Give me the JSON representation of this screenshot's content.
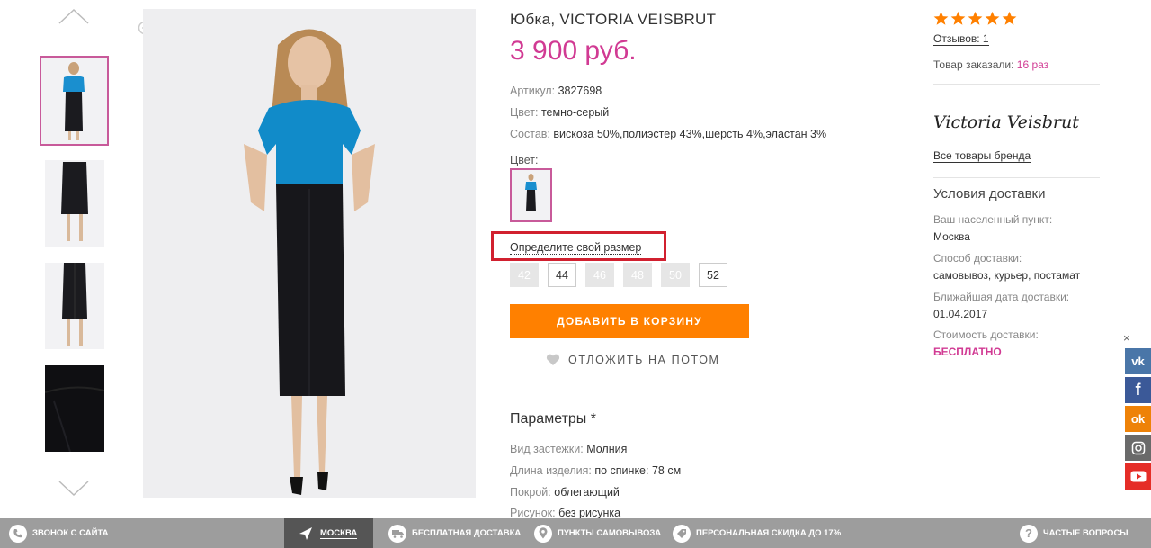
{
  "product": {
    "title": "Юбка, VICTORIA VEISBRUT",
    "price": "3 900 руб.",
    "attributes": [
      {
        "label": "Артикул:",
        "value": "3827698"
      },
      {
        "label": "Цвет:",
        "value": "темно-серый"
      },
      {
        "label": "Состав:",
        "value": "вискоза 50%,полиэстер 43%,шерсть 4%,эластан 3%"
      }
    ],
    "color_label": "Цвет:",
    "size_link": "Определите свой размер",
    "sizes": [
      {
        "label": "42",
        "available": false
      },
      {
        "label": "44",
        "available": true
      },
      {
        "label": "46",
        "available": false
      },
      {
        "label": "48",
        "available": false
      },
      {
        "label": "50",
        "available": false
      },
      {
        "label": "52",
        "available": true
      }
    ],
    "add_to_cart": "ДОБАВИТЬ В КОРЗИНУ",
    "save_later": "ОТЛОЖИТЬ НА ПОТОМ",
    "params_title": "Параметры *",
    "params": [
      {
        "label": "Вид застежки:",
        "value": "Молния"
      },
      {
        "label": "Длина изделия:",
        "value": "по спинке: 78 см"
      },
      {
        "label": "Покрой:",
        "value": "облегающий"
      },
      {
        "label": "Рисунок:",
        "value": "без рисунка"
      }
    ]
  },
  "rating": {
    "stars": 5,
    "star_color": "#ff8000",
    "reviews": "Отзывов: 1",
    "ordered_label": "Товар заказали:",
    "ordered_count": "16 раз"
  },
  "brand": {
    "logo_text": "Victoria Veisbrut",
    "all_link": "Все товары бренда"
  },
  "delivery": {
    "title": "Условия доставки",
    "city_label": "Ваш населенный пункт:",
    "city": "Москва",
    "method_label": "Способ доставки:",
    "method": "самовывоз, курьер, постамат",
    "date_label": "Ближайшая дата доставки:",
    "date": "01.04.2017",
    "cost_label": "Стоимость доставки:",
    "cost": "БЕСПЛАТНО"
  },
  "social": [
    {
      "name": "vk",
      "text": "vk",
      "color": "#4a76a8"
    },
    {
      "name": "facebook",
      "text": "f",
      "color": "#3b5998"
    },
    {
      "name": "odnoklassniki",
      "text": "ok",
      "color": "#ee8208"
    },
    {
      "name": "instagram",
      "text": "",
      "color": "#6a6a6a"
    },
    {
      "name": "youtube",
      "text": "",
      "color": "#e52d27"
    }
  ],
  "bottom_bar": {
    "call": "ЗВОНОК С САЙТА",
    "city": "МОСКВА",
    "free_delivery": "БЕСПЛАТНАЯ ДОСТАВКА",
    "pickup": "ПУНКТЫ САМОВЫВОЗА",
    "discount": "ПЕРСОНАЛЬНАЯ СКИДКА ДО 17%",
    "faq": "ЧАСТЫЕ ВОПРОСЫ"
  },
  "colors": {
    "accent": "#d13a93",
    "button": "#ff8000",
    "highlight_box": "#d1202f",
    "bar": "#9d9d9d"
  }
}
